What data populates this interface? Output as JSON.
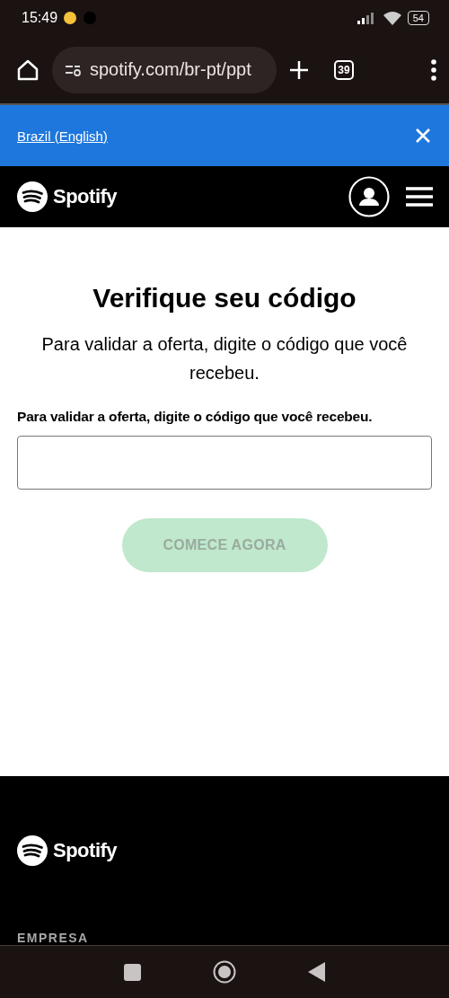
{
  "status_bar": {
    "time": "15:49",
    "battery": "54"
  },
  "browser": {
    "url": "spotify.com/br-pt/ppt",
    "tab_count": "39"
  },
  "region_banner": {
    "link": "Brazil (English)"
  },
  "header": {
    "brand": "Spotify"
  },
  "main": {
    "title": "Verifique seu código",
    "subtitle": "Para validar a oferta, digite o código que você recebeu.",
    "field_label": "Para validar a oferta, digite o código que você recebeu.",
    "button": {
      "label": "COMECE AGORA",
      "disabled": true
    }
  },
  "footer": {
    "brand": "Spotify",
    "section": "EMPRESA"
  }
}
